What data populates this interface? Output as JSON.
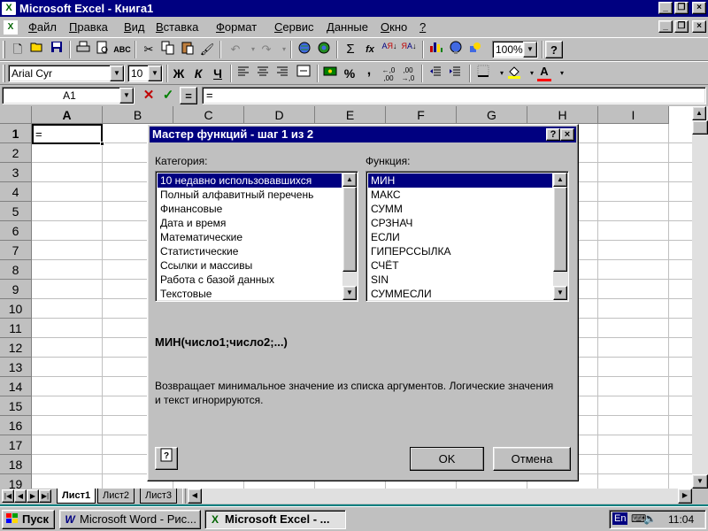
{
  "window": {
    "title": "Microsoft Excel - Книга1"
  },
  "menu": [
    {
      "label": "Файл",
      "u": "Ф",
      "rest": "айл"
    },
    {
      "label": "Правка",
      "u": "П",
      "rest": "равка"
    },
    {
      "label": "Вид",
      "u": "В",
      "rest": "ид"
    },
    {
      "label": "Вставка",
      "u": "В",
      "rest": "ставка"
    },
    {
      "label": "Формат",
      "u": "Ф",
      "rest": "ормат"
    },
    {
      "label": "Сервис",
      "u": "С",
      "rest": "ервис"
    },
    {
      "label": "Данные",
      "u": "Д",
      "rest": "анные"
    },
    {
      "label": "Окно",
      "u": "О",
      "rest": "кно"
    },
    {
      "label": "?",
      "u": "?",
      "rest": ""
    }
  ],
  "toolbar": {
    "zoom": "100%",
    "font_name": "Arial Cyr",
    "font_size": "10",
    "bold": "Ж",
    "italic": "К",
    "underline": "Ч",
    "sum": "Σ",
    "fx": "fx",
    "percent": "%",
    "comma": ",",
    "help": "?"
  },
  "formula_bar": {
    "name_box": "A1",
    "equals": "=",
    "content": "="
  },
  "sheet": {
    "columns": [
      "A",
      "B",
      "C",
      "D",
      "E",
      "F",
      "G",
      "H",
      "I"
    ],
    "rows": [
      "1",
      "2",
      "3",
      "4",
      "5",
      "6",
      "7",
      "8",
      "9",
      "10",
      "11",
      "12",
      "13",
      "14",
      "15",
      "16",
      "17",
      "18",
      "19"
    ],
    "active_cell_value": "=",
    "tabs": [
      "Лист1",
      "Лист2",
      "Лист3"
    ]
  },
  "dialog": {
    "title": "Мастер функций - шаг 1 из 2",
    "category_label": "Категория:",
    "function_label": "Функция:",
    "categories": [
      "10 недавно использовавшихся",
      "Полный алфавитный перечень",
      "Финансовые",
      "Дата и время",
      "Математические",
      "Статистические",
      "Ссылки и массивы",
      "Работа с базой данных",
      "Текстовые"
    ],
    "functions": [
      "МИН",
      "МАКС",
      "СУММ",
      "СРЗНАЧ",
      "ЕСЛИ",
      "ГИПЕРССЫЛКА",
      "СЧЁТ",
      "SIN",
      "СУММЕСЛИ"
    ],
    "selected_category": 0,
    "selected_function": 0,
    "syntax": "МИН(число1;число2;...)",
    "description": "Возвращает минимальное значение из списка аргументов. Логические значения и текст игнорируются.",
    "ok": "OK",
    "cancel": "Отмена"
  },
  "taskbar": {
    "start": "Пуск",
    "tasks": [
      "Microsoft Word - Рис...",
      "Microsoft Excel - ..."
    ],
    "lang": "En",
    "clock": "11:04"
  },
  "colors": {
    "title_bar": "#000080",
    "desktop": "#008080",
    "face": "#c0c0c0",
    "selection": "#000080"
  }
}
